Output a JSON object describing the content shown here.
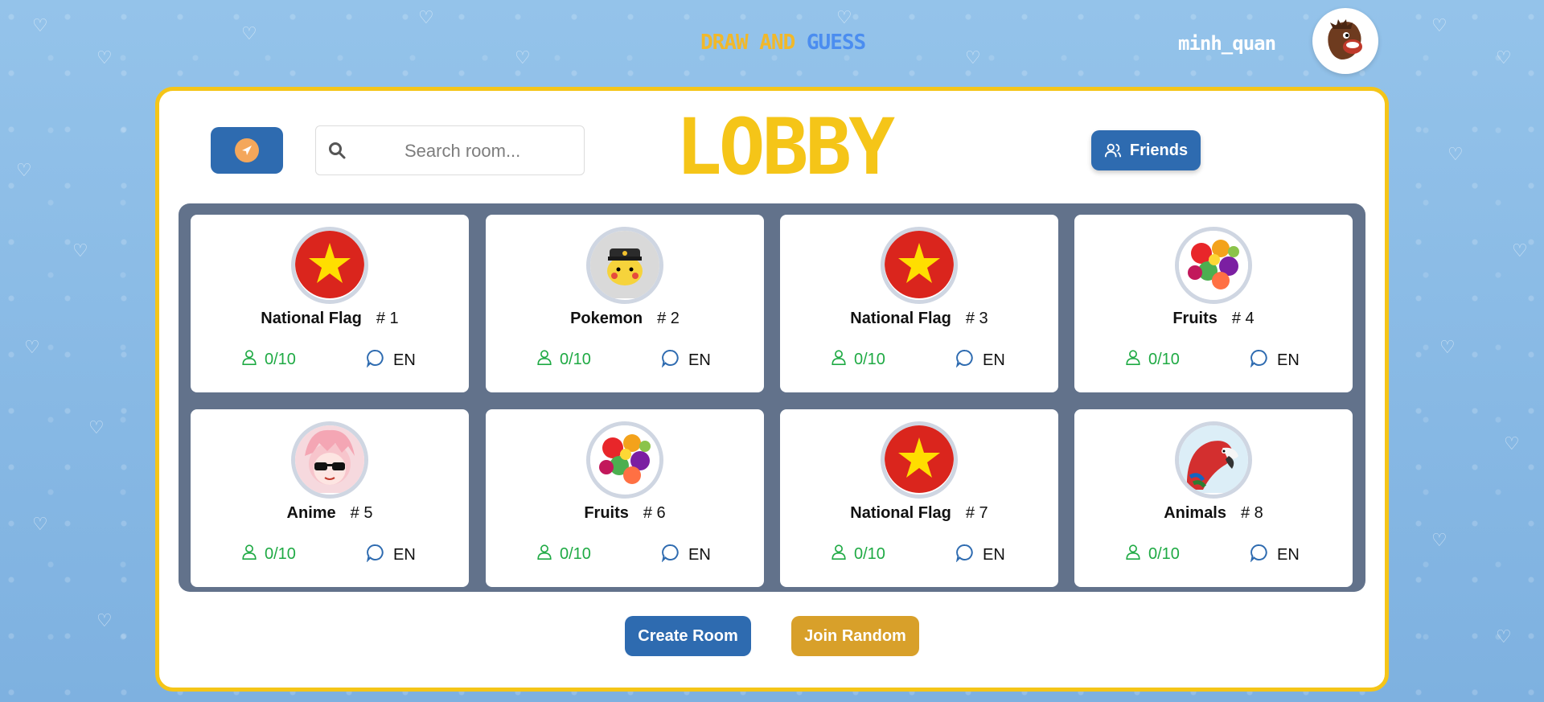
{
  "header": {
    "brand_word1": "DRAW",
    "brand_word2": "AND",
    "brand_word3": "GUESS",
    "username": "minh_quan",
    "avatar_icon": "character-avatar"
  },
  "toolbar": {
    "back_icon": "back-arrow-icon",
    "search_placeholder": "Search room...",
    "lobby_title": "LOBBY",
    "friends_label": "Friends"
  },
  "rooms": [
    {
      "name": "National Flag",
      "number": "# 1",
      "players": "0/10",
      "language": "EN",
      "image": "vietnam-flag"
    },
    {
      "name": "Pokemon",
      "number": "# 2",
      "players": "0/10",
      "language": "EN",
      "image": "pikachu"
    },
    {
      "name": "National Flag",
      "number": "# 3",
      "players": "0/10",
      "language": "EN",
      "image": "vietnam-flag"
    },
    {
      "name": "Fruits",
      "number": "# 4",
      "players": "0/10",
      "language": "EN",
      "image": "fruits"
    },
    {
      "name": "Anime",
      "number": "# 5",
      "players": "0/10",
      "language": "EN",
      "image": "anime-character"
    },
    {
      "name": "Fruits",
      "number": "# 6",
      "players": "0/10",
      "language": "EN",
      "image": "fruits"
    },
    {
      "name": "National Flag",
      "number": "# 7",
      "players": "0/10",
      "language": "EN",
      "image": "vietnam-flag"
    },
    {
      "name": "Animals",
      "number": "# 8",
      "players": "0/10",
      "language": "EN",
      "image": "parrot"
    }
  ],
  "actions": {
    "create_room": "Create Room",
    "join_random": "Join Random"
  },
  "colors": {
    "accent_blue": "#2e6bb0",
    "accent_yellow": "#f5c518",
    "join_gold": "#d8a02a",
    "players_green": "#1faa44"
  }
}
